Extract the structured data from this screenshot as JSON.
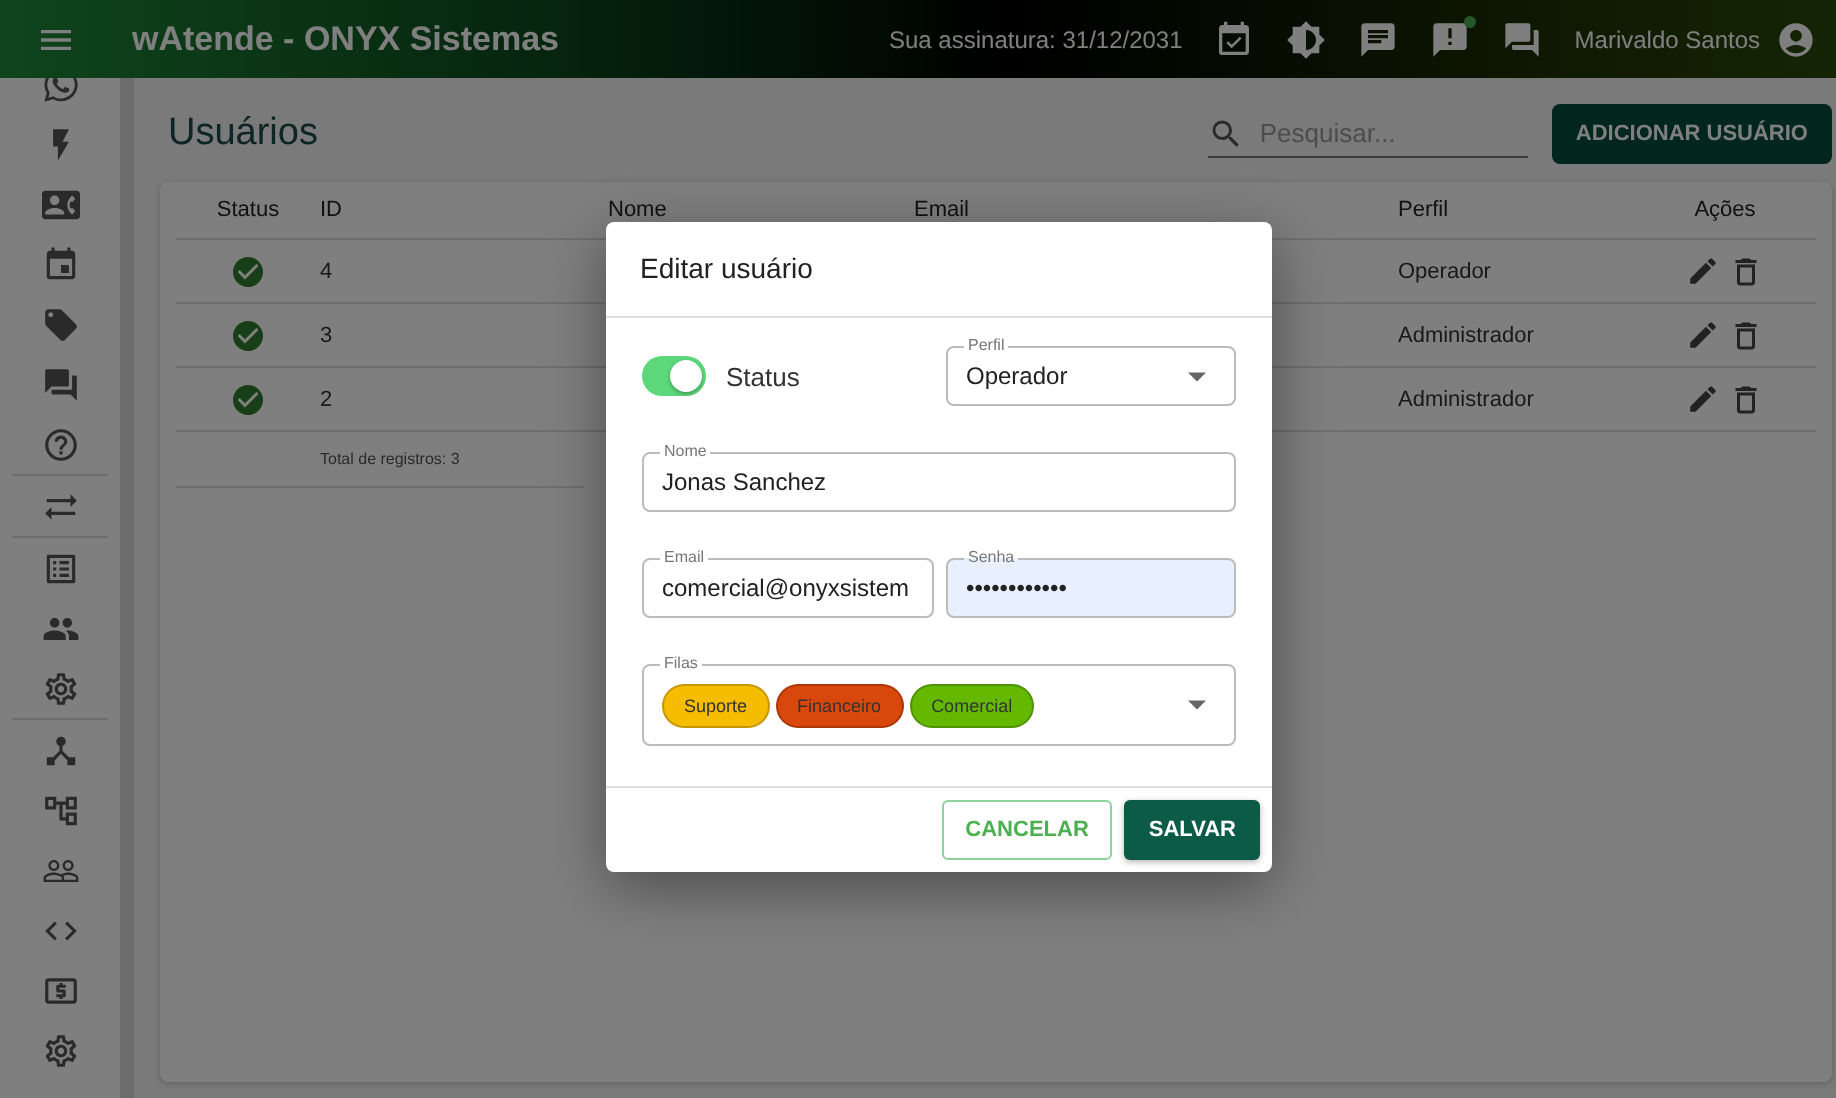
{
  "app_bar": {
    "title": "wAtende - ONYX Sistemas",
    "subscription": "Sua assinatura: 31/12/2031",
    "notification_dot": true,
    "user_name": "Marivaldo Santos"
  },
  "page": {
    "title": "Usuários",
    "search": {
      "placeholder": "Pesquisar..."
    },
    "add_button": "ADICIONAR USUÁRIO"
  },
  "table": {
    "columns": [
      "Status",
      "ID",
      "Nome",
      "Email",
      "Perfil",
      "Ações"
    ],
    "rows": [
      {
        "active": true,
        "id": "4",
        "perfil": "Operador"
      },
      {
        "active": true,
        "id": "3",
        "perfil": "Administrador"
      },
      {
        "active": true,
        "id": "2",
        "perfil": "Administrador"
      }
    ],
    "total": "Total de registros: 3"
  },
  "dialog": {
    "title": "Editar usuário",
    "status": {
      "label": "Status",
      "on": true
    },
    "perfil": {
      "label": "Perfil",
      "value": "Operador"
    },
    "nome": {
      "label": "Nome",
      "value": "Jonas Sanchez"
    },
    "email": {
      "label": "Email",
      "value": "comercial@onyxsistem"
    },
    "senha": {
      "label": "Senha",
      "value": "••••••••••••"
    },
    "filas": {
      "label": "Filas",
      "chips": [
        {
          "label": "Suporte",
          "color": "#f5bc00"
        },
        {
          "label": "Financeiro",
          "color": "#d8470b"
        },
        {
          "label": "Comercial",
          "color": "#64b800"
        }
      ]
    },
    "buttons": {
      "cancel": "CANCELAR",
      "save": "SALVAR"
    }
  }
}
